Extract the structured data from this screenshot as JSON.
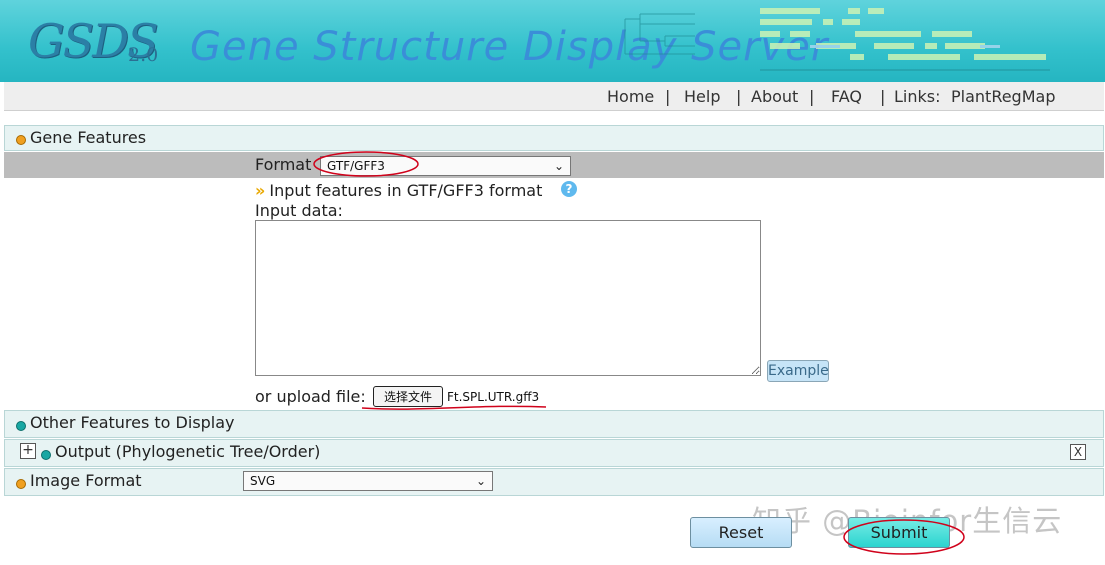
{
  "header": {
    "logo_text": "GSDS",
    "logo_version": "2.0",
    "title": "Gene Structure Display Server"
  },
  "nav": {
    "items": [
      {
        "label": "Home"
      },
      {
        "label": "Help"
      },
      {
        "label": "About"
      },
      {
        "label": "FAQ"
      }
    ],
    "links_label": "Links:",
    "links_item": "PlantRegMap",
    "separator": "|"
  },
  "gene_features": {
    "section_label": "Gene Features",
    "format_label": "Format",
    "format_value": "GTF/GFF3",
    "input_hint": "Input features in GTF/GFF3 format",
    "input_data_label": "Input data:",
    "input_data_value": "",
    "example_button": "Example",
    "upload_label": "or upload file:",
    "file_button_label": "选择文件",
    "file_name": "Ft.SPL.UTR.gff3"
  },
  "other_features": {
    "section_label": "Other Features to Display"
  },
  "output": {
    "section_label": "Output (Phylogenetic Tree/Order)",
    "plus_symbol": "+",
    "close_symbol": "X"
  },
  "image_format": {
    "section_label": "Image Format",
    "value": "SVG"
  },
  "actions": {
    "reset": "Reset",
    "submit": "Submit"
  },
  "watermark": "知乎 @Bioinfor生信云",
  "colors": {
    "banner": "#33c1cc",
    "title": "#3a8ed8",
    "submit": "#2bd4cf",
    "reset": "#b6dcf4",
    "annotation": "#d0021b"
  }
}
